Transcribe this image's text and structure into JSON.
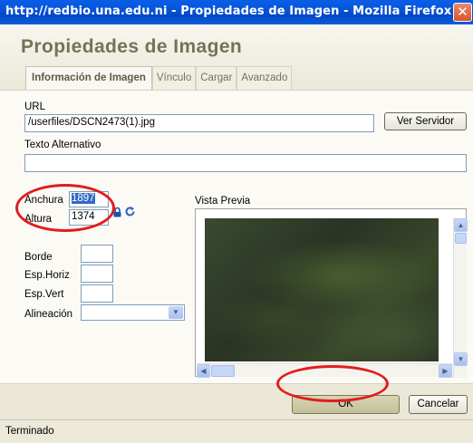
{
  "window": {
    "title": "http://redbio.una.edu.ni - Propiedades de Imagen - Mozilla Firefox",
    "close_label": "✕"
  },
  "dialog": {
    "title": "Propiedades de Imagen",
    "tabs": [
      {
        "label": "Información de Imagen",
        "active": true
      },
      {
        "label": "Vínculo",
        "active": false
      },
      {
        "label": "Cargar",
        "active": false
      },
      {
        "label": "Avanzado",
        "active": false
      }
    ]
  },
  "form": {
    "url_label": "URL",
    "url_value": "/userfiles/DSCN2473(1).jpg",
    "browse_server_label": "Ver Servidor",
    "alt_text_label": "Texto Alternativo",
    "alt_text_value": "",
    "width_label": "Anchura",
    "width_value": "1897",
    "height_label": "Altura",
    "height_value": "1374",
    "border_label": "Borde",
    "border_value": "",
    "hspace_label": "Esp.Horiz",
    "hspace_value": "",
    "vspace_label": "Esp.Vert",
    "vspace_value": "",
    "align_label": "Alineación",
    "align_value": ""
  },
  "preview": {
    "label": "Vista Previa"
  },
  "footer": {
    "ok_label": "OK",
    "cancel_label": "Cancelar"
  },
  "statusbar": {
    "text": "Terminado"
  },
  "icons": {
    "lock": "lock-icon",
    "reset": "reset-size-icon"
  },
  "colors": {
    "titlebar": "#0453d9",
    "annotation": "#e21c1c",
    "selection": "#316ac5"
  }
}
